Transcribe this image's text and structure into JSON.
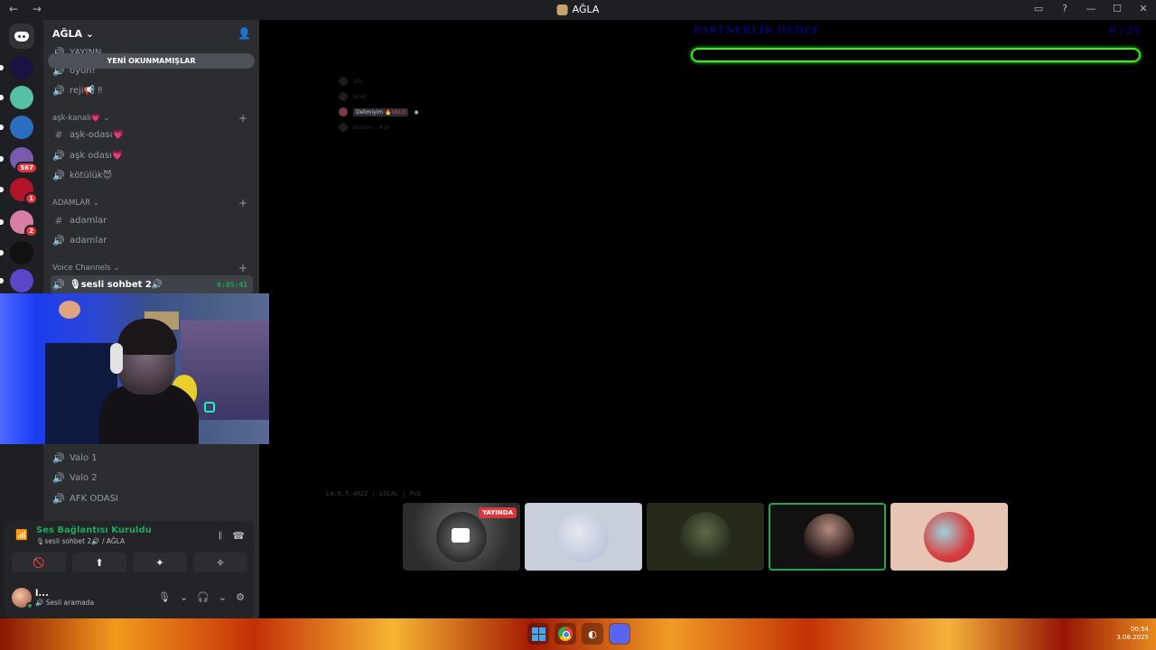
{
  "window": {
    "title": "AĞLA",
    "nav": "← →",
    "controls": [
      "▭",
      "?",
      "—",
      "☐",
      "✕"
    ]
  },
  "server": {
    "name": "AĞLA ⌄",
    "unread_pill": "YENİ OKUNMAMIŞLAR"
  },
  "guilds": [
    {
      "name": "server-1",
      "color": "#1a1240",
      "badge": ""
    },
    {
      "name": "server-2",
      "color": "#58bfa7",
      "badge": ""
    },
    {
      "name": "server-3",
      "color": "#2a6fbf",
      "badge": ""
    },
    {
      "name": "server-4",
      "color": "#7a5ab0",
      "badge": "567"
    },
    {
      "name": "server-5",
      "color": "#b3142a",
      "badge": "1"
    },
    {
      "name": "server-6",
      "color": "#d77fa6",
      "badge": "2"
    },
    {
      "name": "server-7",
      "color": "#111111",
      "badge": ""
    },
    {
      "name": "server-8",
      "color": "#5a46c8",
      "badge": ""
    }
  ],
  "channels": {
    "top_partial": "YAYINN",
    "items_a": [
      {
        "icon": "speaker",
        "label": "oyun!"
      },
      {
        "icon": "speaker",
        "label": "reji📢 ‼"
      }
    ],
    "cat_ask": "aşk-kanalı💗 ⌄",
    "items_b": [
      {
        "icon": "#",
        "label": "aşk-odası💗"
      },
      {
        "icon": "speaker",
        "label": "aşk odası💗"
      },
      {
        "icon": "speaker",
        "label": "kötülük😈"
      }
    ],
    "cat_adamlar": "ADAMLAR ⌄",
    "items_c": [
      {
        "icon": "#",
        "label": "adamlar"
      },
      {
        "icon": "speaker",
        "label": "adamlar"
      }
    ],
    "cat_voice": "Voice Channels ⌄",
    "active_voice": {
      "label": "🎙sesli sohbet 2🔊",
      "timer": "6:05:41"
    },
    "items_d": [
      {
        "icon": "speaker",
        "label": "Valo 1"
      },
      {
        "icon": "speaker",
        "label": "Valo 2"
      },
      {
        "icon": "speaker",
        "label": "AFK ODASI"
      }
    ]
  },
  "voice_panel": {
    "status": "Ses Bağlantısı Kuruldu",
    "sub": "🎙sesli sohbet 2🔊 / AĞLA",
    "buttons": [
      "🚫",
      "⬆",
      "✦",
      "✧"
    ]
  },
  "user": {
    "name": "l...",
    "status": "🔊 Sesli aramada"
  },
  "overlay": {
    "partner_title": "PARTNERLİK HEDEF",
    "partner_count": "0 / 25",
    "partner_progress": 0,
    "list": [
      {
        "name": "ada",
        "tag": "",
        "highlight": false
      },
      {
        "name": "BOAI",
        "tag": "",
        "highlight": false
      },
      {
        "name": "Delimiyim",
        "tag": "🔥VALO",
        "highlight": true
      },
      {
        "name": "bensen",
        "tag": "#10",
        "highlight": false
      }
    ],
    "hud": "L0:6.5.4622 | LOCAL | PvE"
  },
  "tiles": [
    {
      "name": "stream-tile",
      "live": "YAYINDA",
      "selected": false
    },
    {
      "name": "user-tile-2",
      "live": "",
      "selected": false
    },
    {
      "name": "user-tile-3",
      "live": "",
      "selected": false
    },
    {
      "name": "user-tile-4",
      "live": "",
      "selected": true
    },
    {
      "name": "user-tile-5",
      "live": "",
      "selected": false
    }
  ],
  "taskbar": {
    "time": "00:54",
    "date": "3.08.2025"
  }
}
